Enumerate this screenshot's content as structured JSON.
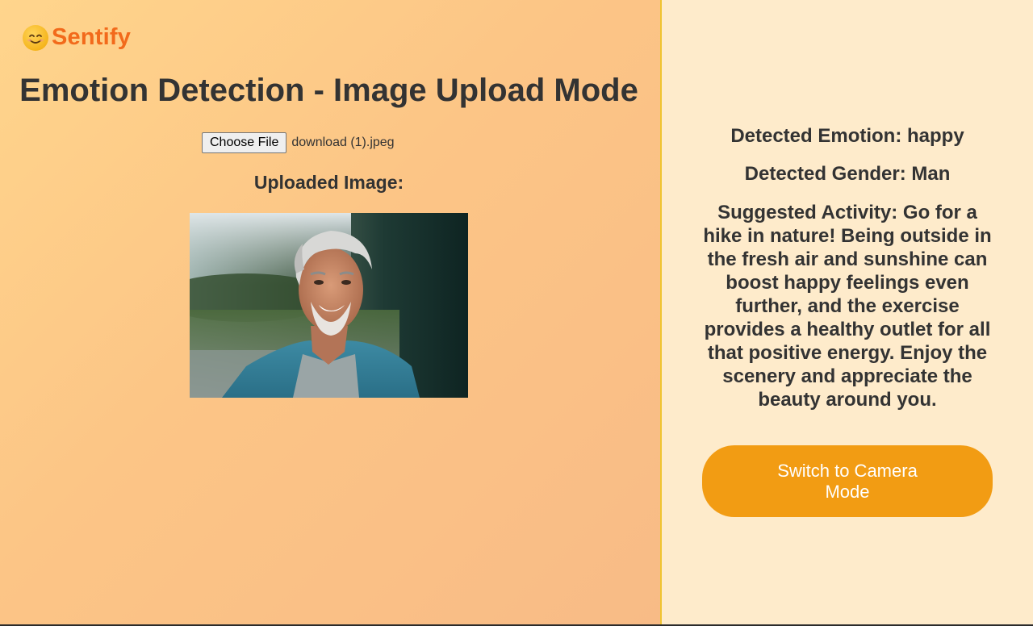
{
  "brand": {
    "icon": "smiling-face-icon",
    "name": "Sentify"
  },
  "header": {
    "title": "Emotion Detection - Image Upload Mode"
  },
  "upload": {
    "button_label": "Choose File",
    "file_name": "download (1).jpeg",
    "uploaded_label": "Uploaded Image:"
  },
  "results": {
    "emotion": "Detected Emotion: happy",
    "gender": "Detected Gender: Man",
    "activity": "Suggested Activity: Go for a hike in nature! Being outside in the fresh air and sunshine can boost happy feelings even further, and the exercise provides a healthy outlet for all that positive energy. Enjoy the scenery and appreciate the beauty around you."
  },
  "actions": {
    "switch_label": "Switch to Camera Mode"
  },
  "colors": {
    "brand": "#f26a1b",
    "accent": "#f29c13",
    "panel": "#feebcb",
    "divider": "#f0c330"
  }
}
